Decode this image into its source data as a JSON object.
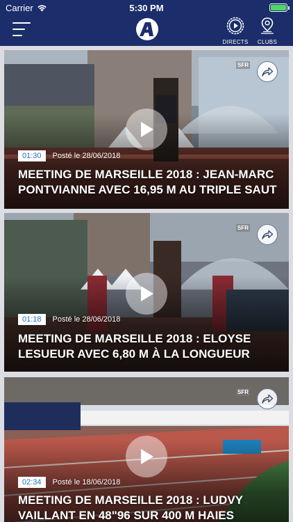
{
  "statusbar": {
    "carrier": "Carrier",
    "time": "5:30 PM"
  },
  "navbar": {
    "directs_label": "DIRECTS",
    "clubs_label": "CLUBS"
  },
  "videos": [
    {
      "duration": "01:30",
      "posted": "Posté le 28/06/2018",
      "title": "MEETING DE MARSEILLE 2018 : JEAN-MARC PONTVIANNE AVEC 16,95 M AU TRIPLE SAUT",
      "watermark": "SFR"
    },
    {
      "duration": "01:18",
      "posted": "Posté le 28/06/2018",
      "title": "MEETING DE MARSEILLE 2018 : ELOYSE LESUEUR AVEC 6,80 M À LA LONGUEUR",
      "watermark": "SFR"
    },
    {
      "duration": "02:34",
      "posted": "Posté le 18/06/2018",
      "title": "MEETING DE MARSEILLE 2018 : LUDVY VAILLANT EN 48\"96 SUR 400 M HAIES",
      "watermark": "SFR"
    }
  ],
  "colors": {
    "navbar": "#1b2d6b",
    "duration_text": "#1f73c9",
    "battery": "#4cd964"
  }
}
